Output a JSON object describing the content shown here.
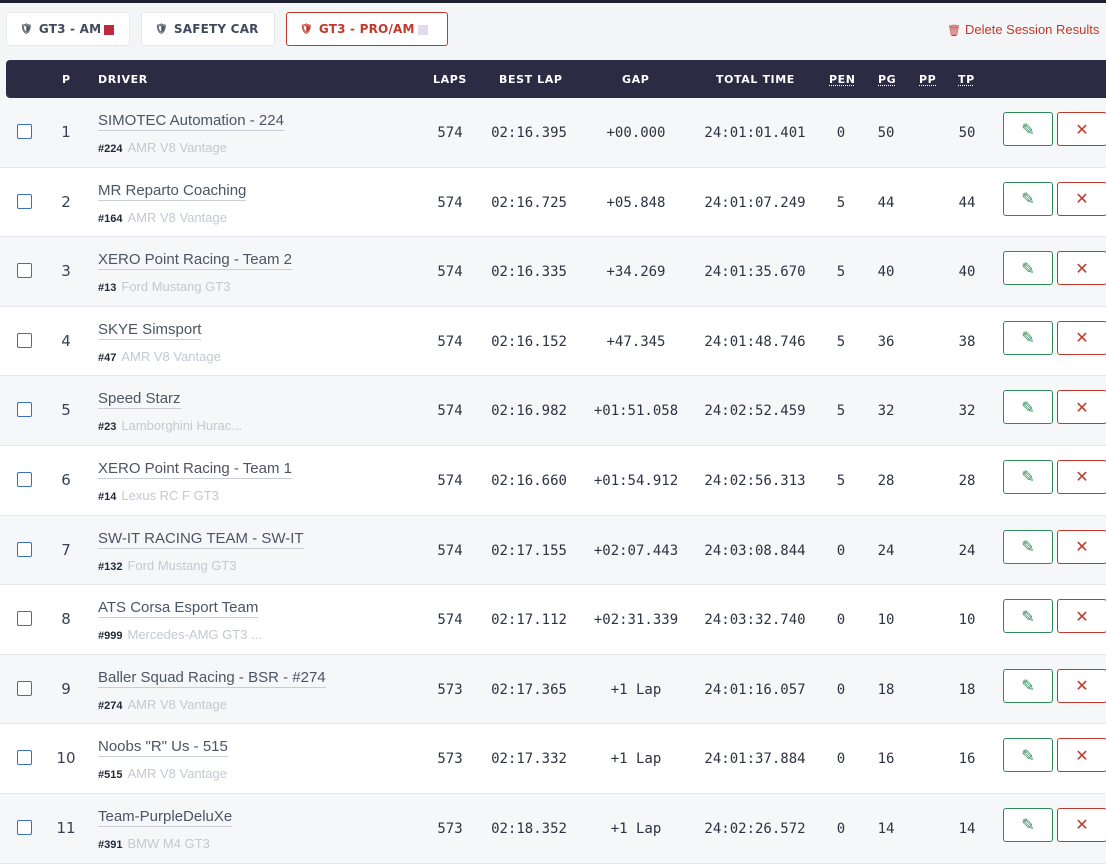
{
  "tabs": [
    {
      "label": "GT3 - AM",
      "swatch": "#c0283d",
      "active": false
    },
    {
      "label": "SAFETY CAR",
      "swatch": "",
      "active": false
    },
    {
      "label": "GT3 - PRO/AM",
      "swatch": "#e2d9ef",
      "active": true
    }
  ],
  "delete_label": "Delete Session Results",
  "columns": {
    "p": "P",
    "driver": "DRIVER",
    "laps": "LAPS",
    "best": "BEST LAP",
    "gap": "GAP",
    "total": "TOTAL TIME",
    "pen": "PEN",
    "pg": "PG",
    "pp": "PP",
    "tp": "TP"
  },
  "icons": {
    "shield": "shield-icon",
    "trash": "trash-icon",
    "edit": "pencil-icon",
    "delete": "close-icon"
  },
  "colors": {
    "header_bg": "#2b2c44",
    "edit": "#2e8b57",
    "delete": "#c0392b"
  },
  "rows": [
    {
      "p": "1",
      "team": "SIMOTEC Automation - 224",
      "num": "#224",
      "car": "AMR V8 Vantage",
      "laps": "574",
      "best": "02:16.395",
      "gap": "+00.000",
      "total": "24:01:01.401",
      "pen": "0",
      "pg": "50",
      "pp": "",
      "tp": "50"
    },
    {
      "p": "2",
      "team": "MR Reparto Coaching",
      "num": "#164",
      "car": "AMR V8 Vantage",
      "laps": "574",
      "best": "02:16.725",
      "gap": "+05.848",
      "total": "24:01:07.249",
      "pen": "5",
      "pg": "44",
      "pp": "",
      "tp": "44"
    },
    {
      "p": "3",
      "team": "XERO Point Racing - Team 2",
      "num": "#13",
      "car": "Ford Mustang GT3",
      "laps": "574",
      "best": "02:16.335",
      "gap": "+34.269",
      "total": "24:01:35.670",
      "pen": "5",
      "pg": "40",
      "pp": "",
      "tp": "40"
    },
    {
      "p": "4",
      "team": "SKYE Simsport",
      "num": "#47",
      "car": "AMR V8 Vantage",
      "laps": "574",
      "best": "02:16.152",
      "gap": "+47.345",
      "total": "24:01:48.746",
      "pen": "5",
      "pg": "36",
      "pp": "",
      "tp": "38"
    },
    {
      "p": "5",
      "team": "Speed Starz",
      "num": "#23",
      "car": "Lamborghini Hurac...",
      "laps": "574",
      "best": "02:16.982",
      "gap": "+01:51.058",
      "total": "24:02:52.459",
      "pen": "5",
      "pg": "32",
      "pp": "",
      "tp": "32"
    },
    {
      "p": "6",
      "team": "XERO Point Racing - Team 1",
      "num": "#14",
      "car": "Lexus RC F GT3",
      "laps": "574",
      "best": "02:16.660",
      "gap": "+01:54.912",
      "total": "24:02:56.313",
      "pen": "5",
      "pg": "28",
      "pp": "",
      "tp": "28"
    },
    {
      "p": "7",
      "team": "SW-IT RACING TEAM - SW-IT",
      "num": "#132",
      "car": "Ford Mustang GT3",
      "laps": "574",
      "best": "02:17.155",
      "gap": "+02:07.443",
      "total": "24:03:08.844",
      "pen": "0",
      "pg": "24",
      "pp": "",
      "tp": "24"
    },
    {
      "p": "8",
      "team": "ATS Corsa Esport Team",
      "num": "#999",
      "car": "Mercedes-AMG GT3 ...",
      "laps": "574",
      "best": "02:17.112",
      "gap": "+02:31.339",
      "total": "24:03:32.740",
      "pen": "0",
      "pg": "10",
      "pp": "",
      "tp": "10"
    },
    {
      "p": "9",
      "team": "Baller Squad Racing - BSR - #274",
      "num": "#274",
      "car": "AMR V8 Vantage",
      "laps": "573",
      "best": "02:17.365",
      "gap": "+1 Lap",
      "total": "24:01:16.057",
      "pen": "0",
      "pg": "18",
      "pp": "",
      "tp": "18"
    },
    {
      "p": "10",
      "team": "Noobs \"R\" Us - 515",
      "num": "#515",
      "car": "AMR V8 Vantage",
      "laps": "573",
      "best": "02:17.332",
      "gap": "+1 Lap",
      "total": "24:01:37.884",
      "pen": "0",
      "pg": "16",
      "pp": "",
      "tp": "16"
    },
    {
      "p": "11",
      "team": "Team-PurpleDeluXe",
      "num": "#391",
      "car": "BMW M4 GT3",
      "laps": "573",
      "best": "02:18.352",
      "gap": "+1 Lap",
      "total": "24:02:26.572",
      "pen": "0",
      "pg": "14",
      "pp": "",
      "tp": "14"
    }
  ]
}
